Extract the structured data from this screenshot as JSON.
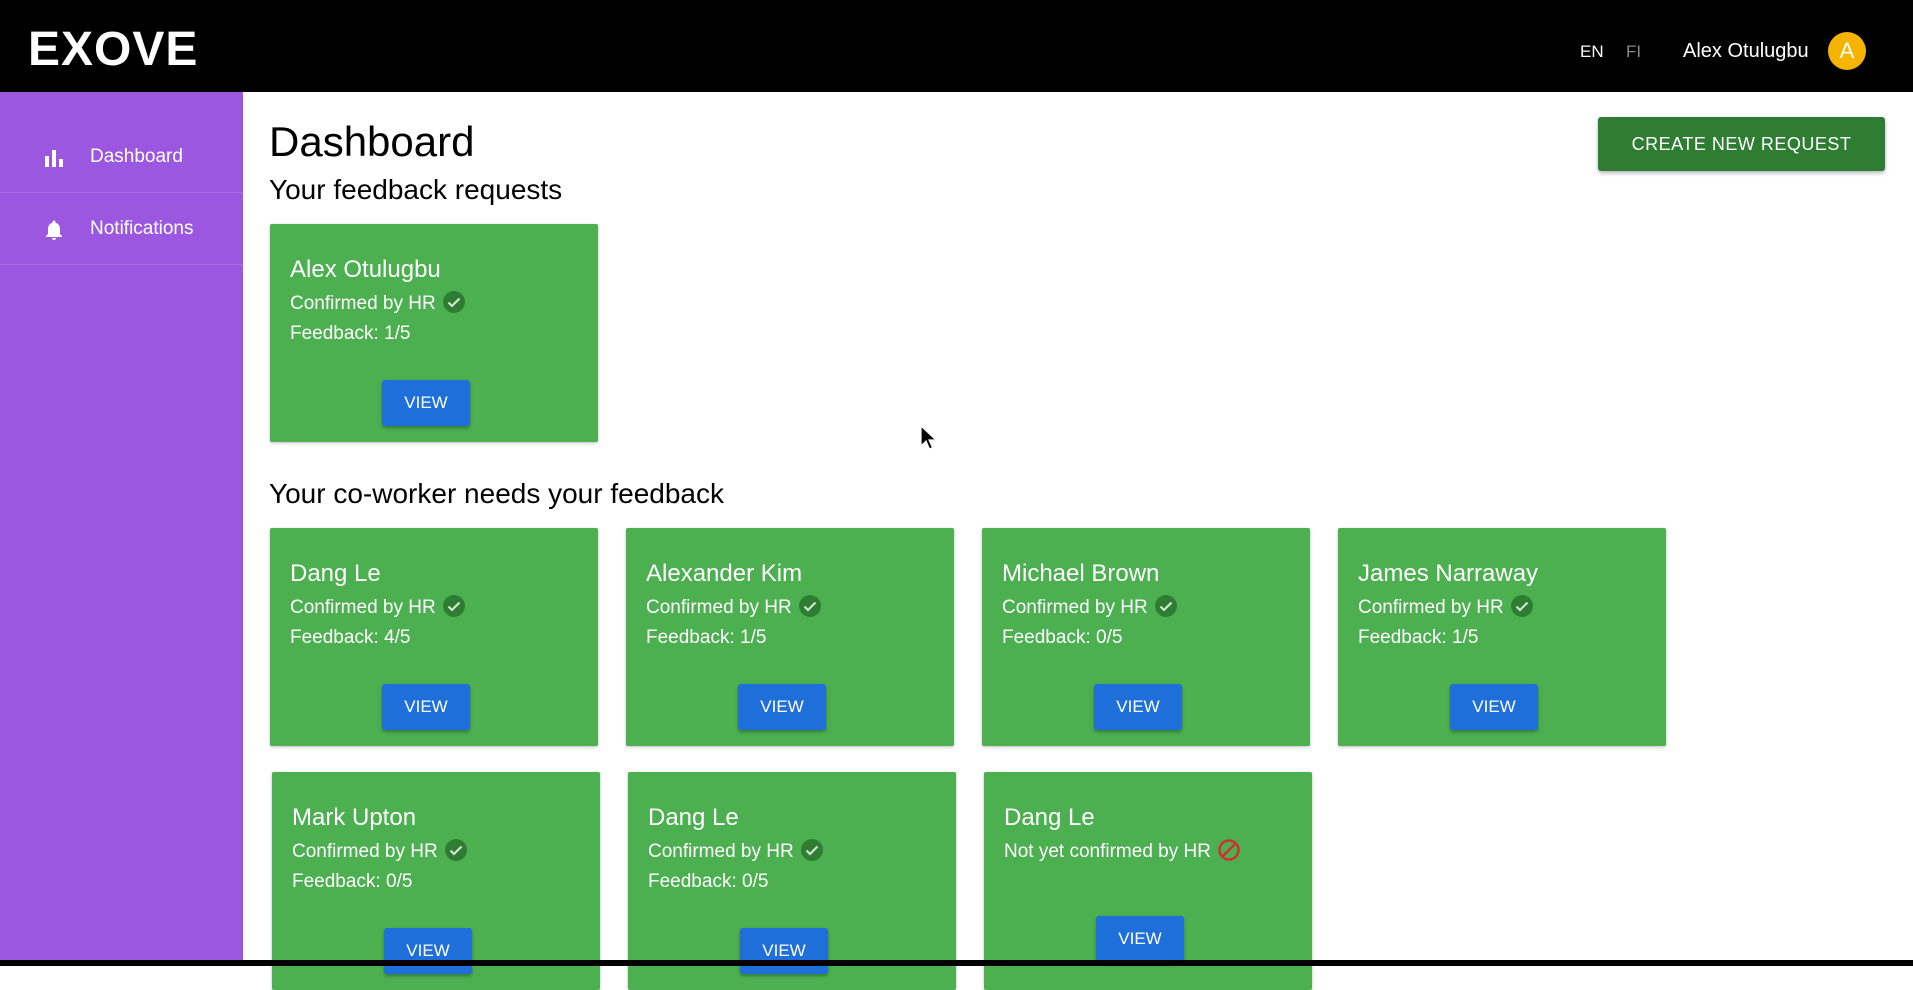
{
  "header": {
    "logo": "EXOVE",
    "languages": [
      "EN",
      "FI"
    ],
    "active_language": "EN",
    "user_name": "Alex Otulugbu",
    "avatar_initial": "A"
  },
  "sidebar": {
    "items": [
      {
        "label": "Dashboard",
        "icon": "bar-chart-icon"
      },
      {
        "label": "Notifications",
        "icon": "bell-icon"
      }
    ]
  },
  "main": {
    "title": "Dashboard",
    "create_button": "CREATE NEW REQUEST",
    "sections": [
      {
        "title": "Your feedback requests",
        "cards": [
          {
            "name": "Alex Otulugbu",
            "status": "Confirmed by HR",
            "confirmed": true,
            "feedback": "Feedback: 1/5",
            "button": "VIEW"
          }
        ]
      },
      {
        "title": "Your co-worker needs your feedback",
        "cards": [
          {
            "name": "Dang Le",
            "status": "Confirmed by HR",
            "confirmed": true,
            "feedback": "Feedback: 4/5",
            "button": "VIEW"
          },
          {
            "name": "Alexander Kim",
            "status": "Confirmed by HR",
            "confirmed": true,
            "feedback": "Feedback: 1/5",
            "button": "VIEW"
          },
          {
            "name": "Michael Brown",
            "status": "Confirmed by HR",
            "confirmed": true,
            "feedback": "Feedback: 0/5",
            "button": "VIEW"
          },
          {
            "name": "James Narraway",
            "status": "Confirmed by HR",
            "confirmed": true,
            "feedback": "Feedback: 1/5",
            "button": "VIEW"
          },
          {
            "name": "Mark Upton",
            "status": "Confirmed by HR",
            "confirmed": true,
            "feedback": "Feedback: 0/5",
            "button": "VIEW"
          },
          {
            "name": "Dang Le",
            "status": "Confirmed by HR",
            "confirmed": true,
            "feedback": "Feedback: 0/5",
            "button": "VIEW"
          },
          {
            "name": "Dang Le",
            "status": "Not yet confirmed by HR",
            "confirmed": false,
            "feedback": "",
            "button": "VIEW"
          }
        ]
      }
    ]
  },
  "colors": {
    "header_bg": "#000000",
    "sidebar_bg": "#9b57e0",
    "card_bg": "#4caf50",
    "view_button_bg": "#1e6fd9",
    "create_button_bg": "#2e7d32",
    "avatar_bg": "#f5b400",
    "confirmed_icon": "#2e7d32",
    "not_confirmed_icon": "#d32f2f"
  }
}
